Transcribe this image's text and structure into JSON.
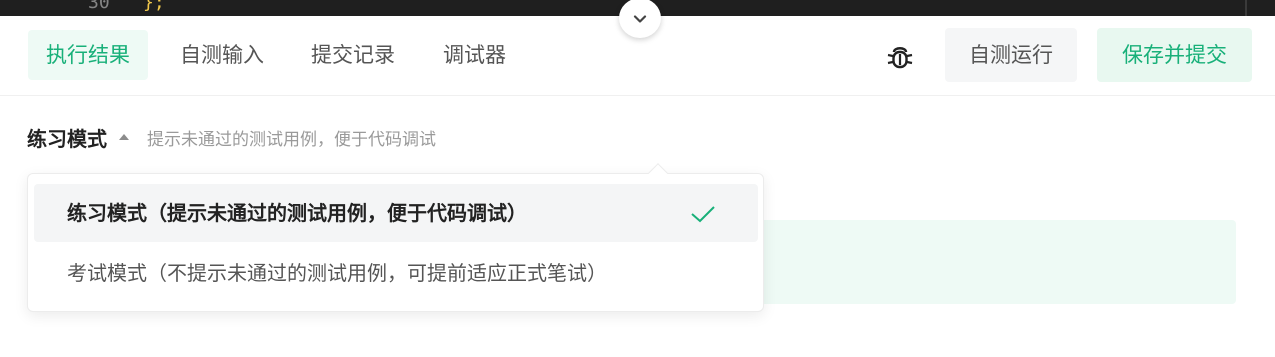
{
  "editor": {
    "line_number": "30",
    "code": "};"
  },
  "toolbar": {
    "tabs": [
      {
        "label": "执行结果",
        "active": true
      },
      {
        "label": "自测输入",
        "active": false
      },
      {
        "label": "提交记录",
        "active": false
      },
      {
        "label": "调试器",
        "active": false
      }
    ],
    "debug_icon": "bug-icon",
    "run_label": "自测运行",
    "submit_label": "保存并提交"
  },
  "mode": {
    "label": "练习模式",
    "caret_icon": "caret-up-icon",
    "hint": "提示未通过的测试用例，便于代码调试"
  },
  "dropdown": {
    "options": [
      {
        "label": "练习模式（提示未通过的测试用例，便于代码调试）",
        "selected": true
      },
      {
        "label": "考试模式（不提示未通过的测试用例，可提前适应正式笔试）",
        "selected": false
      }
    ],
    "check_icon": "check-icon"
  },
  "colors": {
    "accent": "#18b079",
    "accent_bg": "#eefaf5",
    "editor_bg": "#1f1f1f"
  }
}
